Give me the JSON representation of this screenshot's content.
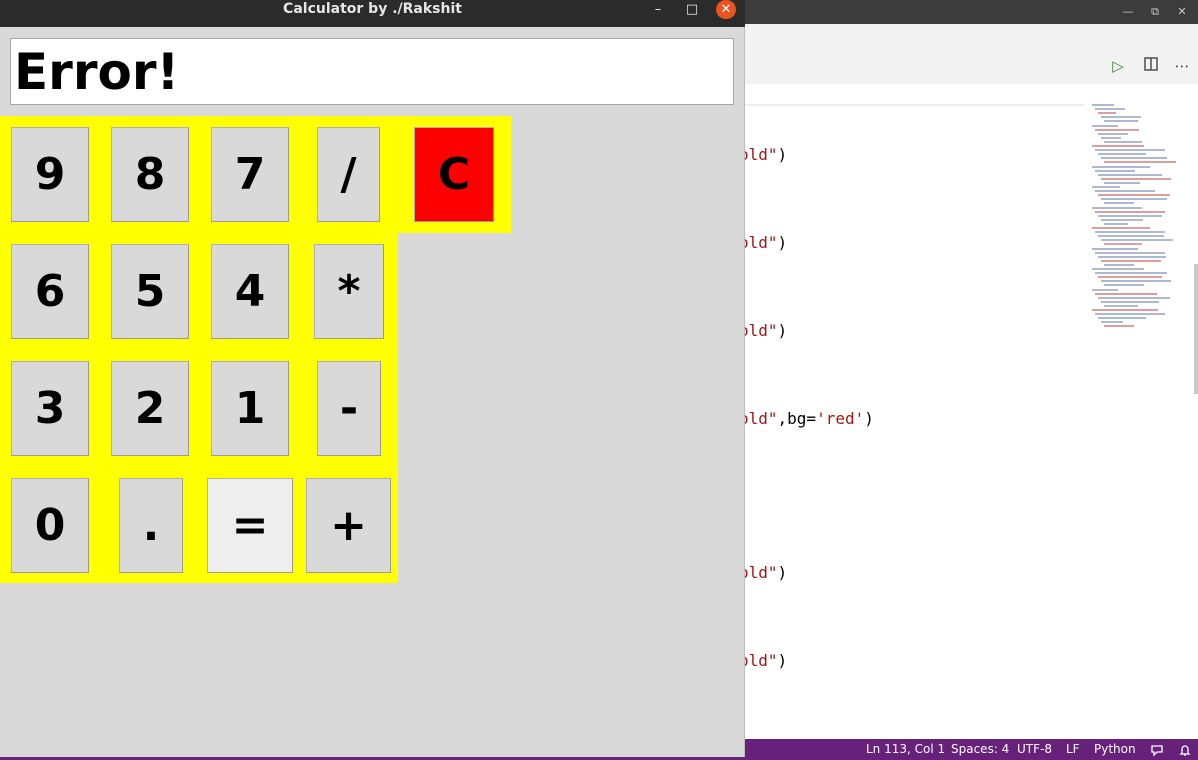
{
  "calculator": {
    "window_title": "Calculator by ./Rakshit",
    "display": "Error!",
    "buttons": {
      "nine": "9",
      "eight": "8",
      "seven": "7",
      "divide": "/",
      "clear": "C",
      "six": "6",
      "five": "5",
      "four": "4",
      "multiply": "*",
      "three": "3",
      "two": "2",
      "one": "1",
      "minus": "-",
      "zero": "0",
      "dot": ".",
      "equals": "=",
      "plus": "+"
    },
    "window_controls": {
      "minimize": "–",
      "maximize": "□",
      "close": "✕"
    },
    "colors": {
      "panel": "#ffff00",
      "clear_button": "#ff0000",
      "display_bg": "#ffffff"
    }
  },
  "editor": {
    "code": {
      "line1_str": "old\"",
      "line1_rest": ")",
      "line2_str": "old\"",
      "line2_rest": ")",
      "line3_str": "old\"",
      "line3_rest": ")",
      "line4_str1": "old\"",
      "line4_mid": ",bg=",
      "line4_str2": "'red'",
      "line4_rest": ")",
      "line5_str": "old\"",
      "line5_rest": ")",
      "line6_str": "old\"",
      "line6_rest": ")"
    },
    "status": {
      "position": "Ln 113, Col 1",
      "spaces": "Spaces: 4",
      "encoding": "UTF-8",
      "eol": "LF",
      "language": "Python"
    },
    "colors": {
      "status_bar": "#68217a",
      "string": "#a31515"
    }
  }
}
